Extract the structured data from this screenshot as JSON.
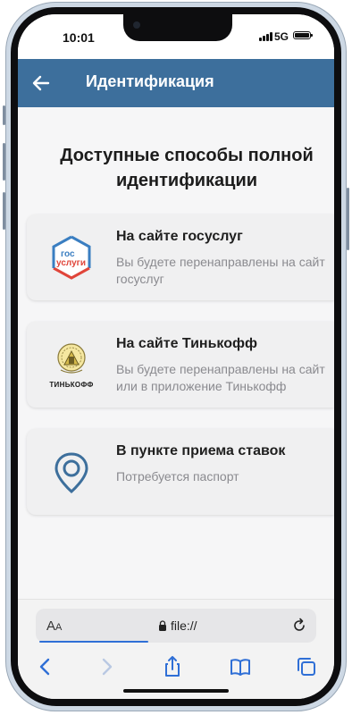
{
  "status_bar": {
    "time": "10:01",
    "network": "5G"
  },
  "header": {
    "title": "Идентификация",
    "back_icon": "arrow-left-icon"
  },
  "main": {
    "heading": "Доступные способы полной идентификации",
    "options": [
      {
        "title": "На сайте госуслуг",
        "description": "Вы будете перенаправлены на сайт госуслуг",
        "logo_line1": "гос",
        "logo_line2": "услуги"
      },
      {
        "title": "На сайте Тинькофф",
        "description": "Вы будете перенаправлены на сайт или в приложение Тинькофф",
        "logo_text": "ТИНЬКОФФ"
      },
      {
        "title": "В пункте приема ставок",
        "description": "Потребуется паспорт",
        "icon": "location-pin-icon"
      }
    ]
  },
  "browser": {
    "text_size_label": "A",
    "text_size_small": "A",
    "url": "file://",
    "toolbar_icons": [
      "back-icon",
      "forward-icon",
      "share-icon",
      "bookmarks-icon",
      "tabs-icon"
    ]
  },
  "colors": {
    "header": "#3d6f9c",
    "accent": "#2f6fd6",
    "gos_blue": "#3a7ec1",
    "gos_red": "#e0453a",
    "pin": "#3d6f9c"
  }
}
